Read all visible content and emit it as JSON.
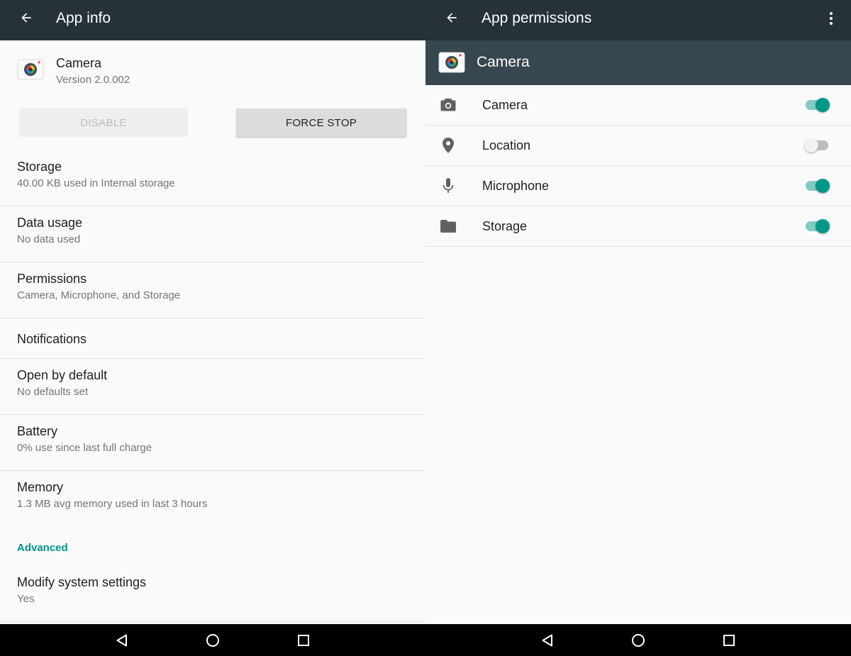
{
  "left": {
    "appbar": {
      "title": "App info"
    },
    "app": {
      "name": "Camera",
      "version": "Version 2.0.002"
    },
    "buttons": {
      "disable": "DISABLE",
      "force_stop": "FORCE STOP"
    },
    "settings": [
      {
        "title": "Storage",
        "subtitle": "40.00 KB used in Internal storage"
      },
      {
        "title": "Data usage",
        "subtitle": "No data used"
      },
      {
        "title": "Permissions",
        "subtitle": "Camera, Microphone, and Storage"
      },
      {
        "title": "Notifications",
        "subtitle": ""
      },
      {
        "title": "Open by default",
        "subtitle": "No defaults set"
      },
      {
        "title": "Battery",
        "subtitle": "0% use since last full charge"
      },
      {
        "title": "Memory",
        "subtitle": "1.3 MB avg memory used in last 3 hours"
      }
    ],
    "advanced": {
      "header": "Advanced",
      "items": [
        {
          "title": "Modify system settings",
          "subtitle": "Yes"
        }
      ]
    }
  },
  "right": {
    "appbar": {
      "title": "App permissions"
    },
    "app_band": {
      "title": "Camera"
    },
    "permissions": [
      {
        "label": "Camera",
        "icon": "camera-icon",
        "enabled": true
      },
      {
        "label": "Location",
        "icon": "location-pin-icon",
        "enabled": false
      },
      {
        "label": "Microphone",
        "icon": "microphone-icon",
        "enabled": true
      },
      {
        "label": "Storage",
        "icon": "folder-icon",
        "enabled": true
      }
    ]
  },
  "colors": {
    "appbar": "#263238",
    "app_band": "#37474f",
    "accent": "#009688",
    "accent_light": "#80cbc4"
  }
}
